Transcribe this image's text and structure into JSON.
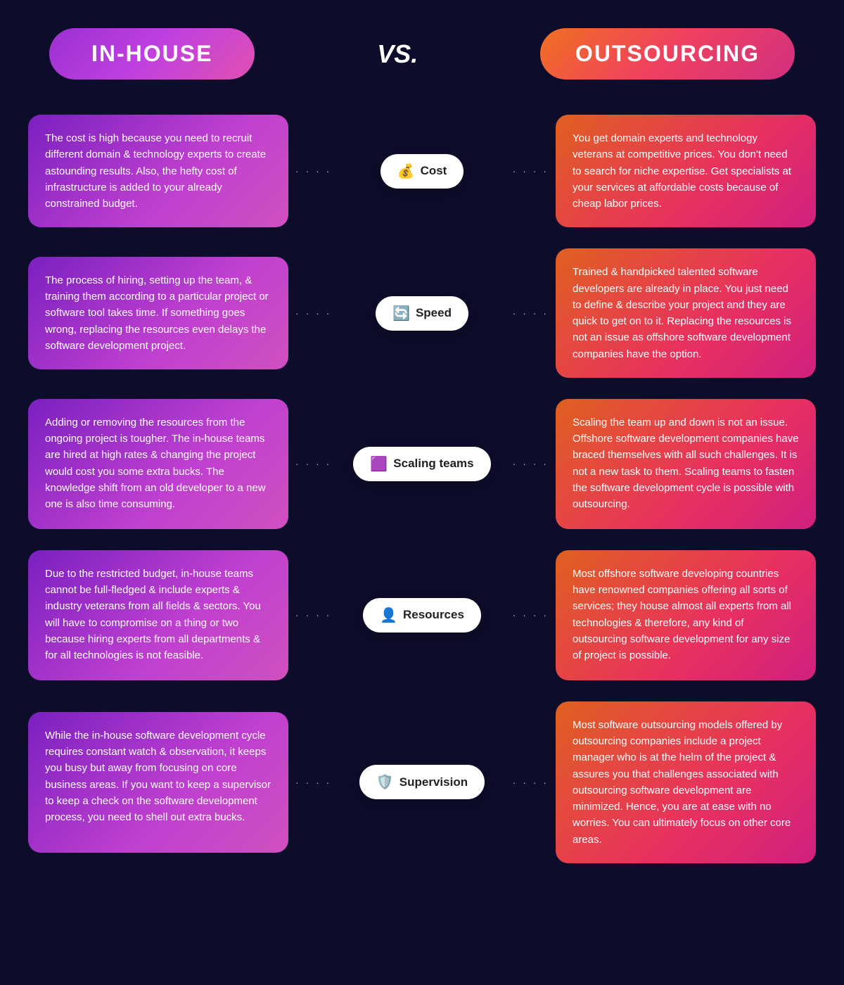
{
  "header": {
    "inhouse_label": "IN-HOUSE",
    "vs_label": "VS.",
    "outsourcing_label": "OUTSOURCING"
  },
  "rows": [
    {
      "id": "cost",
      "badge_icon": "💰",
      "badge_label": "Cost",
      "left_text": "The cost is high because you need to recruit different domain & technology experts to create astounding results. Also, the hefty cost of infrastructure is added to your already constrained budget.",
      "right_text": "You get domain experts and technology veterans at competitive prices. You don't need to search for niche expertise. Get specialists at your services at affordable costs because of cheap labor prices."
    },
    {
      "id": "speed",
      "badge_icon": "🔄",
      "badge_label": "Speed",
      "left_text": "The process of hiring, setting up the team, & training them according to a particular project or software tool takes time. If something goes wrong, replacing the resources even delays the software development project.",
      "right_text": "Trained & handpicked talented software developers are already in place. You just need to define & describe your project and they are quick to get on to it. Replacing the resources is not an issue as offshore software development companies have the option."
    },
    {
      "id": "scaling",
      "badge_icon": "🟪",
      "badge_label": "Scaling teams",
      "left_text": "Adding or removing the resources from the ongoing project is tougher. The in-house teams are hired at high rates & changing the project would cost you some extra bucks. The knowledge shift from an old developer to a new one is also time consuming.",
      "right_text": "Scaling the team up and down is not an issue. Offshore software development companies have braced themselves with all such challenges. It is not a new task to them. Scaling teams to fasten the software development cycle is possible with outsourcing."
    },
    {
      "id": "resources",
      "badge_icon": "👤",
      "badge_label": "Resources",
      "left_text": "Due to the restricted budget, in-house teams cannot be full-fledged & include experts & industry veterans from all fields & sectors. You will have to compromise on a thing or two because hiring experts from all departments & for all technologies is not feasible.",
      "right_text": "Most offshore software developing countries have renowned companies offering all sorts of services; they house almost all experts from all technologies & therefore, any kind of outsourcing software development for any size of project is possible."
    },
    {
      "id": "supervision",
      "badge_icon": "🛡️",
      "badge_label": "Supervision",
      "left_text": "While the in-house software development cycle requires constant watch & observation, it keeps you busy but away from focusing on core business areas. If you want to keep a supervisor to keep a check on the software development process, you need to shell out extra bucks.",
      "right_text": "Most software outsourcing models offered by outsourcing companies include a project manager who is at the helm of the project & assures you that challenges associated with outsourcing software development are minimized. Hence, you are at ease with no worries. You can ultimately focus on other core areas."
    }
  ]
}
